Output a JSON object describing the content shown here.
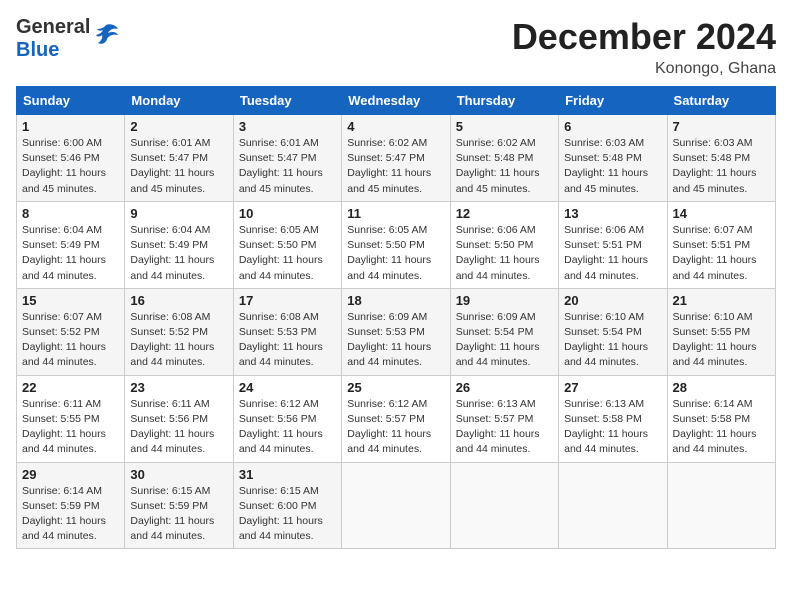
{
  "header": {
    "logo_general": "General",
    "logo_blue": "Blue",
    "month": "December 2024",
    "location": "Konongo, Ghana"
  },
  "weekdays": [
    "Sunday",
    "Monday",
    "Tuesday",
    "Wednesday",
    "Thursday",
    "Friday",
    "Saturday"
  ],
  "weeks": [
    [
      {
        "day": "1",
        "sunrise": "6:00 AM",
        "sunset": "5:46 PM",
        "daylight": "11 hours and 45 minutes."
      },
      {
        "day": "2",
        "sunrise": "6:01 AM",
        "sunset": "5:47 PM",
        "daylight": "11 hours and 45 minutes."
      },
      {
        "day": "3",
        "sunrise": "6:01 AM",
        "sunset": "5:47 PM",
        "daylight": "11 hours and 45 minutes."
      },
      {
        "day": "4",
        "sunrise": "6:02 AM",
        "sunset": "5:47 PM",
        "daylight": "11 hours and 45 minutes."
      },
      {
        "day": "5",
        "sunrise": "6:02 AM",
        "sunset": "5:48 PM",
        "daylight": "11 hours and 45 minutes."
      },
      {
        "day": "6",
        "sunrise": "6:03 AM",
        "sunset": "5:48 PM",
        "daylight": "11 hours and 45 minutes."
      },
      {
        "day": "7",
        "sunrise": "6:03 AM",
        "sunset": "5:48 PM",
        "daylight": "11 hours and 45 minutes."
      }
    ],
    [
      {
        "day": "8",
        "sunrise": "6:04 AM",
        "sunset": "5:49 PM",
        "daylight": "11 hours and 44 minutes."
      },
      {
        "day": "9",
        "sunrise": "6:04 AM",
        "sunset": "5:49 PM",
        "daylight": "11 hours and 44 minutes."
      },
      {
        "day": "10",
        "sunrise": "6:05 AM",
        "sunset": "5:50 PM",
        "daylight": "11 hours and 44 minutes."
      },
      {
        "day": "11",
        "sunrise": "6:05 AM",
        "sunset": "5:50 PM",
        "daylight": "11 hours and 44 minutes."
      },
      {
        "day": "12",
        "sunrise": "6:06 AM",
        "sunset": "5:50 PM",
        "daylight": "11 hours and 44 minutes."
      },
      {
        "day": "13",
        "sunrise": "6:06 AM",
        "sunset": "5:51 PM",
        "daylight": "11 hours and 44 minutes."
      },
      {
        "day": "14",
        "sunrise": "6:07 AM",
        "sunset": "5:51 PM",
        "daylight": "11 hours and 44 minutes."
      }
    ],
    [
      {
        "day": "15",
        "sunrise": "6:07 AM",
        "sunset": "5:52 PM",
        "daylight": "11 hours and 44 minutes."
      },
      {
        "day": "16",
        "sunrise": "6:08 AM",
        "sunset": "5:52 PM",
        "daylight": "11 hours and 44 minutes."
      },
      {
        "day": "17",
        "sunrise": "6:08 AM",
        "sunset": "5:53 PM",
        "daylight": "11 hours and 44 minutes."
      },
      {
        "day": "18",
        "sunrise": "6:09 AM",
        "sunset": "5:53 PM",
        "daylight": "11 hours and 44 minutes."
      },
      {
        "day": "19",
        "sunrise": "6:09 AM",
        "sunset": "5:54 PM",
        "daylight": "11 hours and 44 minutes."
      },
      {
        "day": "20",
        "sunrise": "6:10 AM",
        "sunset": "5:54 PM",
        "daylight": "11 hours and 44 minutes."
      },
      {
        "day": "21",
        "sunrise": "6:10 AM",
        "sunset": "5:55 PM",
        "daylight": "11 hours and 44 minutes."
      }
    ],
    [
      {
        "day": "22",
        "sunrise": "6:11 AM",
        "sunset": "5:55 PM",
        "daylight": "11 hours and 44 minutes."
      },
      {
        "day": "23",
        "sunrise": "6:11 AM",
        "sunset": "5:56 PM",
        "daylight": "11 hours and 44 minutes."
      },
      {
        "day": "24",
        "sunrise": "6:12 AM",
        "sunset": "5:56 PM",
        "daylight": "11 hours and 44 minutes."
      },
      {
        "day": "25",
        "sunrise": "6:12 AM",
        "sunset": "5:57 PM",
        "daylight": "11 hours and 44 minutes."
      },
      {
        "day": "26",
        "sunrise": "6:13 AM",
        "sunset": "5:57 PM",
        "daylight": "11 hours and 44 minutes."
      },
      {
        "day": "27",
        "sunrise": "6:13 AM",
        "sunset": "5:58 PM",
        "daylight": "11 hours and 44 minutes."
      },
      {
        "day": "28",
        "sunrise": "6:14 AM",
        "sunset": "5:58 PM",
        "daylight": "11 hours and 44 minutes."
      }
    ],
    [
      {
        "day": "29",
        "sunrise": "6:14 AM",
        "sunset": "5:59 PM",
        "daylight": "11 hours and 44 minutes."
      },
      {
        "day": "30",
        "sunrise": "6:15 AM",
        "sunset": "5:59 PM",
        "daylight": "11 hours and 44 minutes."
      },
      {
        "day": "31",
        "sunrise": "6:15 AM",
        "sunset": "6:00 PM",
        "daylight": "11 hours and 44 minutes."
      },
      null,
      null,
      null,
      null
    ]
  ],
  "labels": {
    "sunrise": "Sunrise:",
    "sunset": "Sunset:",
    "daylight": "Daylight:"
  }
}
